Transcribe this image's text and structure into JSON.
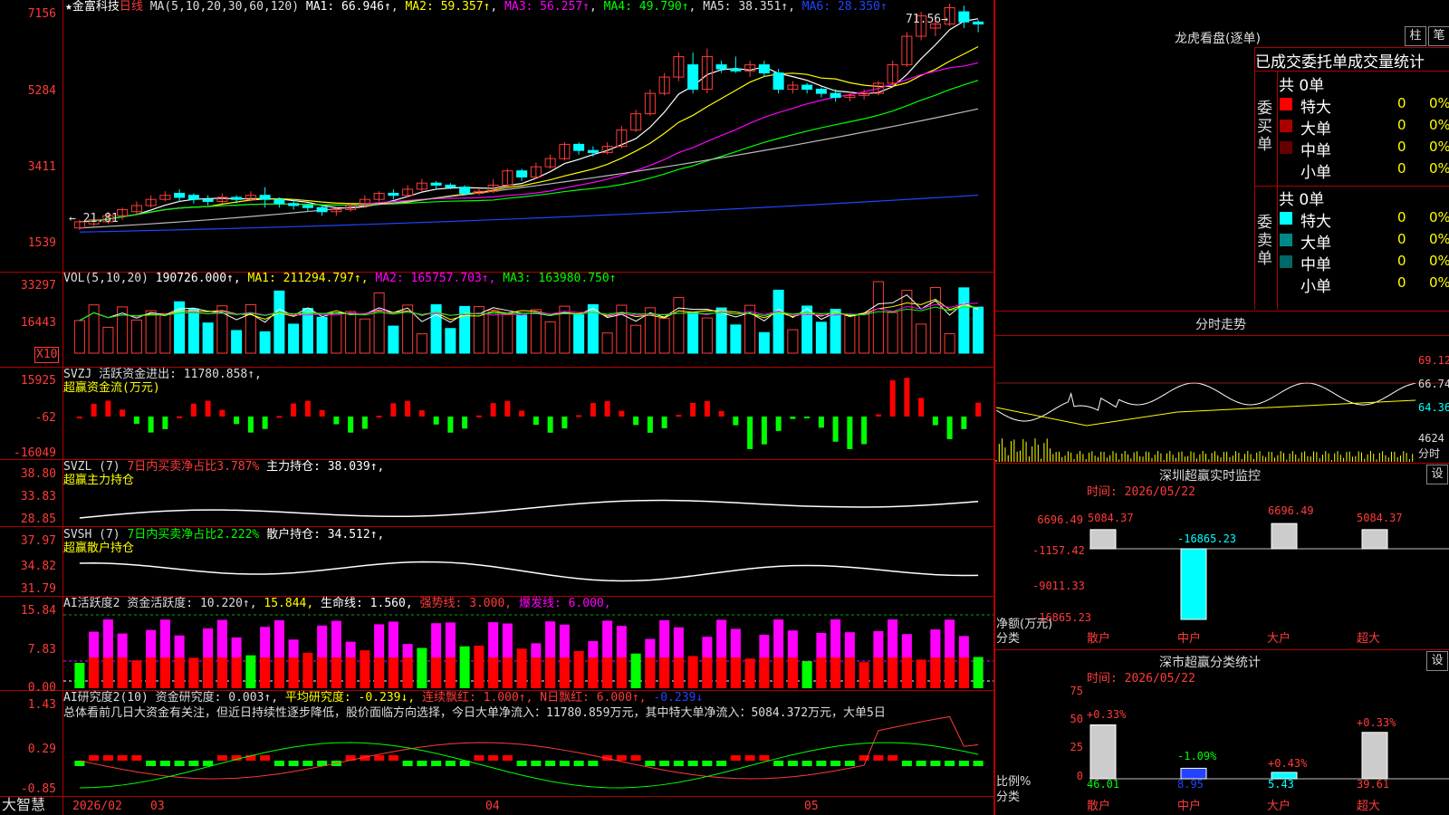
{
  "stock": {
    "star": "★",
    "name": "金富科技",
    "period": "日线",
    "ma_params": "MA(5,10,20,30,60,120)",
    "ma1": "MA1: 66.946↑",
    "ma2": "MA2: 59.357↑",
    "ma3": "MA3: 56.257↑",
    "ma4": "MA4: 49.790↑",
    "ma5": "MA5: 38.351↑",
    "ma6": "MA6: 28.350↑",
    "high_mark": "71.56→",
    "low_mark": "← 21.81",
    "date_hint": "2026/02"
  },
  "price_axis": [
    "7156",
    "5284",
    "3411",
    "1539"
  ],
  "vol": {
    "label": "VOL(5,10,20)",
    "value": "190726.000↑,",
    "ma1": "MA1: 211294.797↑,",
    "ma2": "MA2: 165757.703↑,",
    "ma3": "MA3: 163980.750↑",
    "axis": [
      "33297",
      "16443"
    ],
    "unit": "X10"
  },
  "svzj": {
    "label": "SVZJ 活跃资金进出: 11780.858↑,",
    "sub": "超赢资金流(万元)",
    "axis": [
      "15925",
      "-62",
      "-16049"
    ]
  },
  "svzl": {
    "label": "SVZL (7)",
    "desc": "7日内买卖净占比3.787%",
    "hold": "主力持仓: 38.039↑,",
    "sub": "超赢主力持仓",
    "axis": [
      "38.80",
      "33.83",
      "28.85"
    ]
  },
  "svsh": {
    "label": "SVSH (7)",
    "desc": "7日内买卖净占比2.222%",
    "hold": "散户持仓: 34.512↑,",
    "sub": "超赢散户持仓",
    "axis": [
      "37.97",
      "34.82",
      "31.79"
    ]
  },
  "ai1": {
    "label": "AI活跃度2 资金活跃度: 10.220↑,",
    "v2": "15.844,",
    "life": "生命线: 1.560,",
    "strong": "强势线: 3.000,",
    "burst": "爆发线: 6.000,",
    "axis": [
      "15.84",
      "7.83",
      "0.00"
    ]
  },
  "ai2": {
    "label": "AI研究度2(10) 资金研究度: 0.003↑,",
    "avg": "平均研究度: -0.239↓,",
    "cont": "连续飘红: 1.000↑,",
    "nday": "N日飘红: 6.000↑,",
    "neg": "-0.239↓",
    "summary": "总体看前几日大资金有关注，但近日持续性逐步降低，股价面临方向选择，今日大单净流入：11780.859万元，其中特大单净流入：5084.372万元，大单5日",
    "axis": [
      "1.43",
      "0.29",
      "-0.85"
    ]
  },
  "bottom": {
    "brand": "大智慧",
    "date": "2026/02",
    "m3": "03",
    "m4": "04",
    "m5": "05"
  },
  "right": {
    "title": "龙虎看盘(逐单)",
    "btn1": "柱",
    "btn2": "笔",
    "header": "已成交委托单成交量统计",
    "buy_label": "委买单",
    "sell_label": "委卖单",
    "buy_total": "共 0单",
    "sell_total": "共 0单",
    "buy_rows": [
      {
        "name": "特大",
        "v": "0",
        "p": "0%",
        "color": "#ff0000"
      },
      {
        "name": "大单",
        "v": "0",
        "p": "0%",
        "color": "#aa0000"
      },
      {
        "name": "中单",
        "v": "0",
        "p": "0%",
        "color": "#660000"
      },
      {
        "name": "小单",
        "v": "0",
        "p": "0%",
        "color": "#000000"
      }
    ],
    "sell_rows": [
      {
        "name": "特大",
        "v": "0",
        "p": "0%",
        "color": "#00ffff"
      },
      {
        "name": "大单",
        "v": "0",
        "p": "0%",
        "color": "#008888"
      },
      {
        "name": "中单",
        "v": "0",
        "p": "0%",
        "color": "#006666"
      },
      {
        "name": "小单",
        "v": "0",
        "p": "0%",
        "color": "#000000"
      }
    ],
    "intraday": "分时走势",
    "intra_axis": [
      "69.12",
      "66.74",
      "64.36",
      "4624"
    ],
    "intra_time": "分时",
    "monitor": "深圳超赢实时监控",
    "set": "设",
    "time_label": "时间: 2026/05/22",
    "mon_axis": [
      "6696.49",
      "-1157.42",
      "-9011.33",
      "-16865.23"
    ],
    "mon_vals": [
      "5084.37",
      "-16865.23",
      "6696.49",
      "5084.37"
    ],
    "mon_foot": "净额(万元)",
    "fen": "分类",
    "cats": [
      "散户",
      "中户",
      "大户",
      "超大"
    ],
    "stat": "深市超赢分类统计",
    "stat_axis": [
      "75",
      "50",
      "25",
      "0"
    ],
    "stat_pct": [
      "+0.33%",
      "-1.09%",
      "+0.43%",
      "+0.33%"
    ],
    "stat_vals": [
      "46.01",
      "8.95",
      "5.43",
      "39.61"
    ],
    "stat_foot": "比例%"
  },
  "chart_data": {
    "type": "candlestick",
    "candles": [
      [
        1.9,
        2.05,
        1.85,
        2.1
      ],
      [
        2.0,
        2.1,
        1.95,
        2.15
      ],
      [
        2.05,
        2.2,
        2.0,
        2.3
      ],
      [
        2.2,
        2.35,
        2.1,
        2.4
      ],
      [
        2.3,
        2.45,
        2.25,
        2.55
      ],
      [
        2.45,
        2.6,
        2.4,
        2.7
      ],
      [
        2.6,
        2.7,
        2.55,
        2.8
      ],
      [
        2.75,
        2.65,
        2.55,
        2.85
      ],
      [
        2.7,
        2.6,
        2.5,
        2.75
      ],
      [
        2.6,
        2.55,
        2.45,
        2.7
      ],
      [
        2.55,
        2.65,
        2.5,
        2.75
      ],
      [
        2.65,
        2.6,
        2.5,
        2.7
      ],
      [
        2.6,
        2.7,
        2.55,
        2.8
      ],
      [
        2.7,
        2.6,
        2.4,
        2.9
      ],
      [
        2.6,
        2.5,
        2.4,
        2.65
      ],
      [
        2.5,
        2.45,
        2.35,
        2.6
      ],
      [
        2.45,
        2.4,
        2.3,
        2.5
      ],
      [
        2.4,
        2.3,
        2.2,
        2.45
      ],
      [
        2.3,
        2.35,
        2.2,
        2.4
      ],
      [
        2.35,
        2.45,
        2.3,
        2.5
      ],
      [
        2.45,
        2.6,
        2.4,
        2.7
      ],
      [
        2.6,
        2.75,
        2.55,
        2.8
      ],
      [
        2.75,
        2.7,
        2.6,
        2.85
      ],
      [
        2.7,
        2.85,
        2.65,
        2.95
      ],
      [
        2.85,
        3.0,
        2.8,
        3.1
      ],
      [
        3.0,
        2.95,
        2.85,
        3.05
      ],
      [
        2.95,
        2.9,
        2.85,
        3.0
      ],
      [
        2.9,
        2.75,
        2.7,
        2.95
      ],
      [
        2.75,
        2.8,
        2.7,
        2.85
      ],
      [
        2.8,
        2.95,
        2.75,
        3.1
      ],
      [
        2.95,
        3.3,
        2.9,
        3.35
      ],
      [
        3.3,
        3.15,
        3.05,
        3.35
      ],
      [
        3.15,
        3.4,
        3.1,
        3.5
      ],
      [
        3.4,
        3.6,
        3.35,
        3.7
      ],
      [
        3.6,
        3.95,
        3.55,
        4.0
      ],
      [
        3.95,
        3.8,
        3.7,
        4.0
      ],
      [
        3.8,
        3.75,
        3.65,
        3.9
      ],
      [
        3.75,
        3.9,
        3.7,
        4.0
      ],
      [
        3.9,
        4.3,
        3.85,
        4.4
      ],
      [
        4.3,
        4.7,
        4.25,
        4.8
      ],
      [
        4.7,
        5.2,
        4.65,
        5.3
      ],
      [
        5.2,
        5.6,
        5.15,
        5.7
      ],
      [
        5.6,
        6.1,
        5.5,
        6.2
      ],
      [
        5.9,
        5.3,
        5.2,
        6.2
      ],
      [
        5.3,
        6.1,
        5.2,
        6.3
      ],
      [
        5.9,
        5.8,
        5.7,
        6.0
      ],
      [
        5.8,
        5.75,
        5.7,
        6.1
      ],
      [
        5.75,
        5.9,
        5.6,
        6.0
      ],
      [
        5.9,
        5.7,
        5.6,
        6.0
      ],
      [
        5.7,
        5.3,
        5.2,
        5.8
      ],
      [
        5.3,
        5.4,
        5.2,
        5.5
      ],
      [
        5.4,
        5.3,
        5.2,
        5.45
      ],
      [
        5.3,
        5.2,
        5.1,
        5.35
      ],
      [
        5.2,
        5.1,
        5.0,
        5.3
      ],
      [
        5.1,
        5.15,
        5.0,
        5.25
      ],
      [
        5.15,
        5.2,
        5.05,
        5.3
      ],
      [
        5.2,
        5.45,
        5.15,
        5.5
      ],
      [
        5.45,
        5.9,
        5.4,
        6.0
      ],
      [
        5.9,
        6.6,
        5.85,
        6.7
      ],
      [
        6.6,
        7.1,
        6.5,
        7.2
      ],
      [
        6.8,
        6.9,
        6.6,
        7.1
      ],
      [
        6.9,
        7.3,
        6.85,
        7.4
      ],
      [
        7.2,
        6.95,
        6.8,
        7.35
      ],
      [
        6.95,
        6.9,
        6.7,
        7.0
      ]
    ],
    "y_range": [
      1.539,
      7.156
    ],
    "price_axis_labels": [
      "7156",
      "5284",
      "3411",
      "1539"
    ]
  }
}
